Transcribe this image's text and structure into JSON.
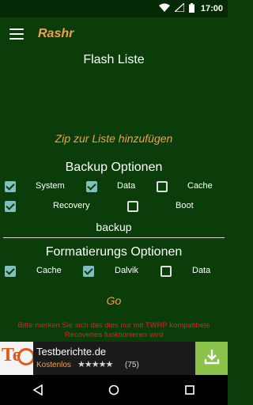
{
  "status_bar": {
    "time": "17:00"
  },
  "app_bar": {
    "title": "Rashr"
  },
  "flash_list": {
    "title": "Flash Liste",
    "add_zip_link": "Zip zur Liste hinzufügen"
  },
  "backup": {
    "title": "Backup Optionen",
    "options": [
      {
        "label": "System",
        "checked": true
      },
      {
        "label": "Data",
        "checked": true
      },
      {
        "label": "Cache",
        "checked": false
      },
      {
        "label": "Recovery",
        "checked": true
      },
      {
        "label": "Boot",
        "checked": false
      }
    ],
    "name_value": "backup"
  },
  "format": {
    "title": "Formatierungs Optionen",
    "options": [
      {
        "label": "Cache",
        "checked": true
      },
      {
        "label": "Dalvik",
        "checked": true
      },
      {
        "label": "Data",
        "checked": false
      }
    ]
  },
  "go_button": "Go",
  "warning": "Bitte merken Sie sich das dies nur mit TWRP kompatibele Recoveries funktionieren wird",
  "ad": {
    "logo_text": "Te",
    "title": "Testberichte.de",
    "subtitle": "Kostenlos",
    "stars": "★★★★★",
    "rating": 4.5,
    "review_count": "(75)"
  },
  "colors": {
    "background": "#0a3d0a",
    "accent": "#f0a04a",
    "warning": "#e02020",
    "checkbox": "#7fbfbf",
    "download": "#8bc34a"
  }
}
